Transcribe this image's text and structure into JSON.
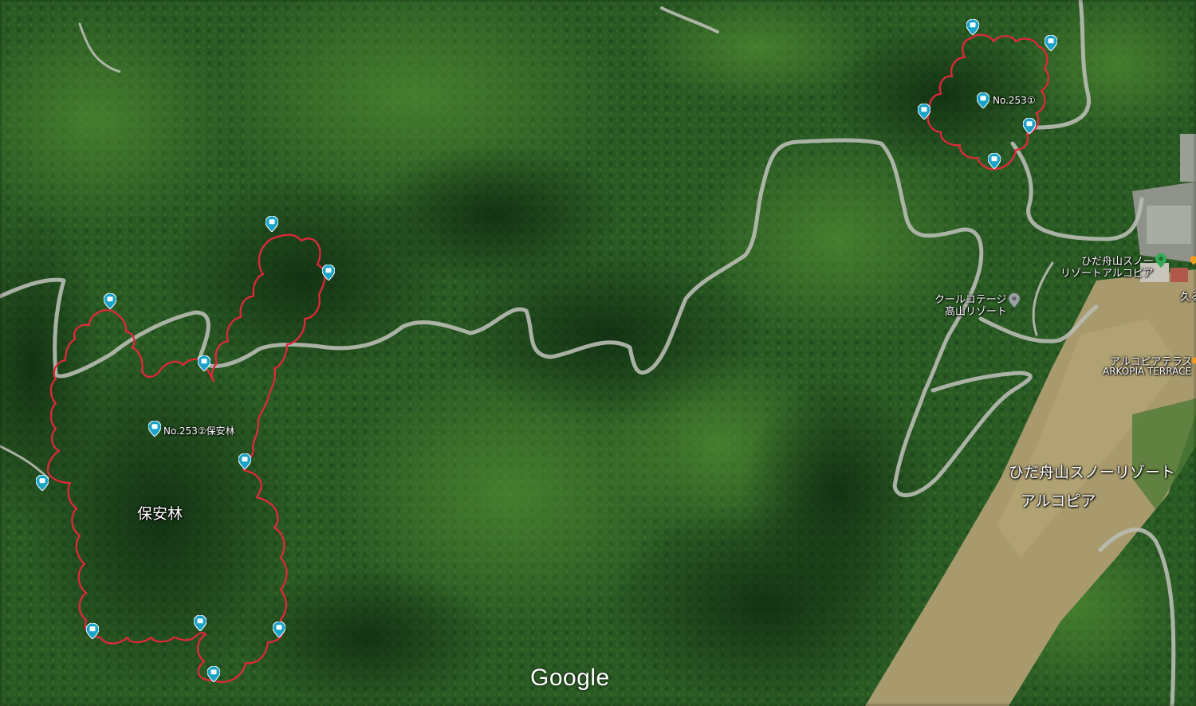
{
  "map": {
    "markers": [
      {
        "id": "m1",
        "label": "No.253①"
      },
      {
        "id": "m2",
        "label": "No.253②保安林"
      }
    ],
    "area_labels": {
      "hoanrin": "保安林",
      "resort_line1": "ひだ舟山スノーリゾート",
      "resort_line2": "アルコピア"
    },
    "poi": {
      "resort_line1": "ひだ舟山スノー",
      "resort_line2": "リゾートアルコピア",
      "cottage_line1": "クールコテージ",
      "cottage_line2": "高山リゾート",
      "terrace_line1": "アルコピアテラス",
      "terrace_line2": "ARKOPIA TERRACE",
      "edge_text": "久る"
    },
    "attribution": "Google",
    "colors": {
      "boundary": "#e0283a",
      "marker": "#1aa3c8",
      "road": "#b9bcb4",
      "poi_green": "#34a853",
      "poi_gray": "#9aa0a6",
      "poi_orange": "#f29d1c"
    }
  }
}
